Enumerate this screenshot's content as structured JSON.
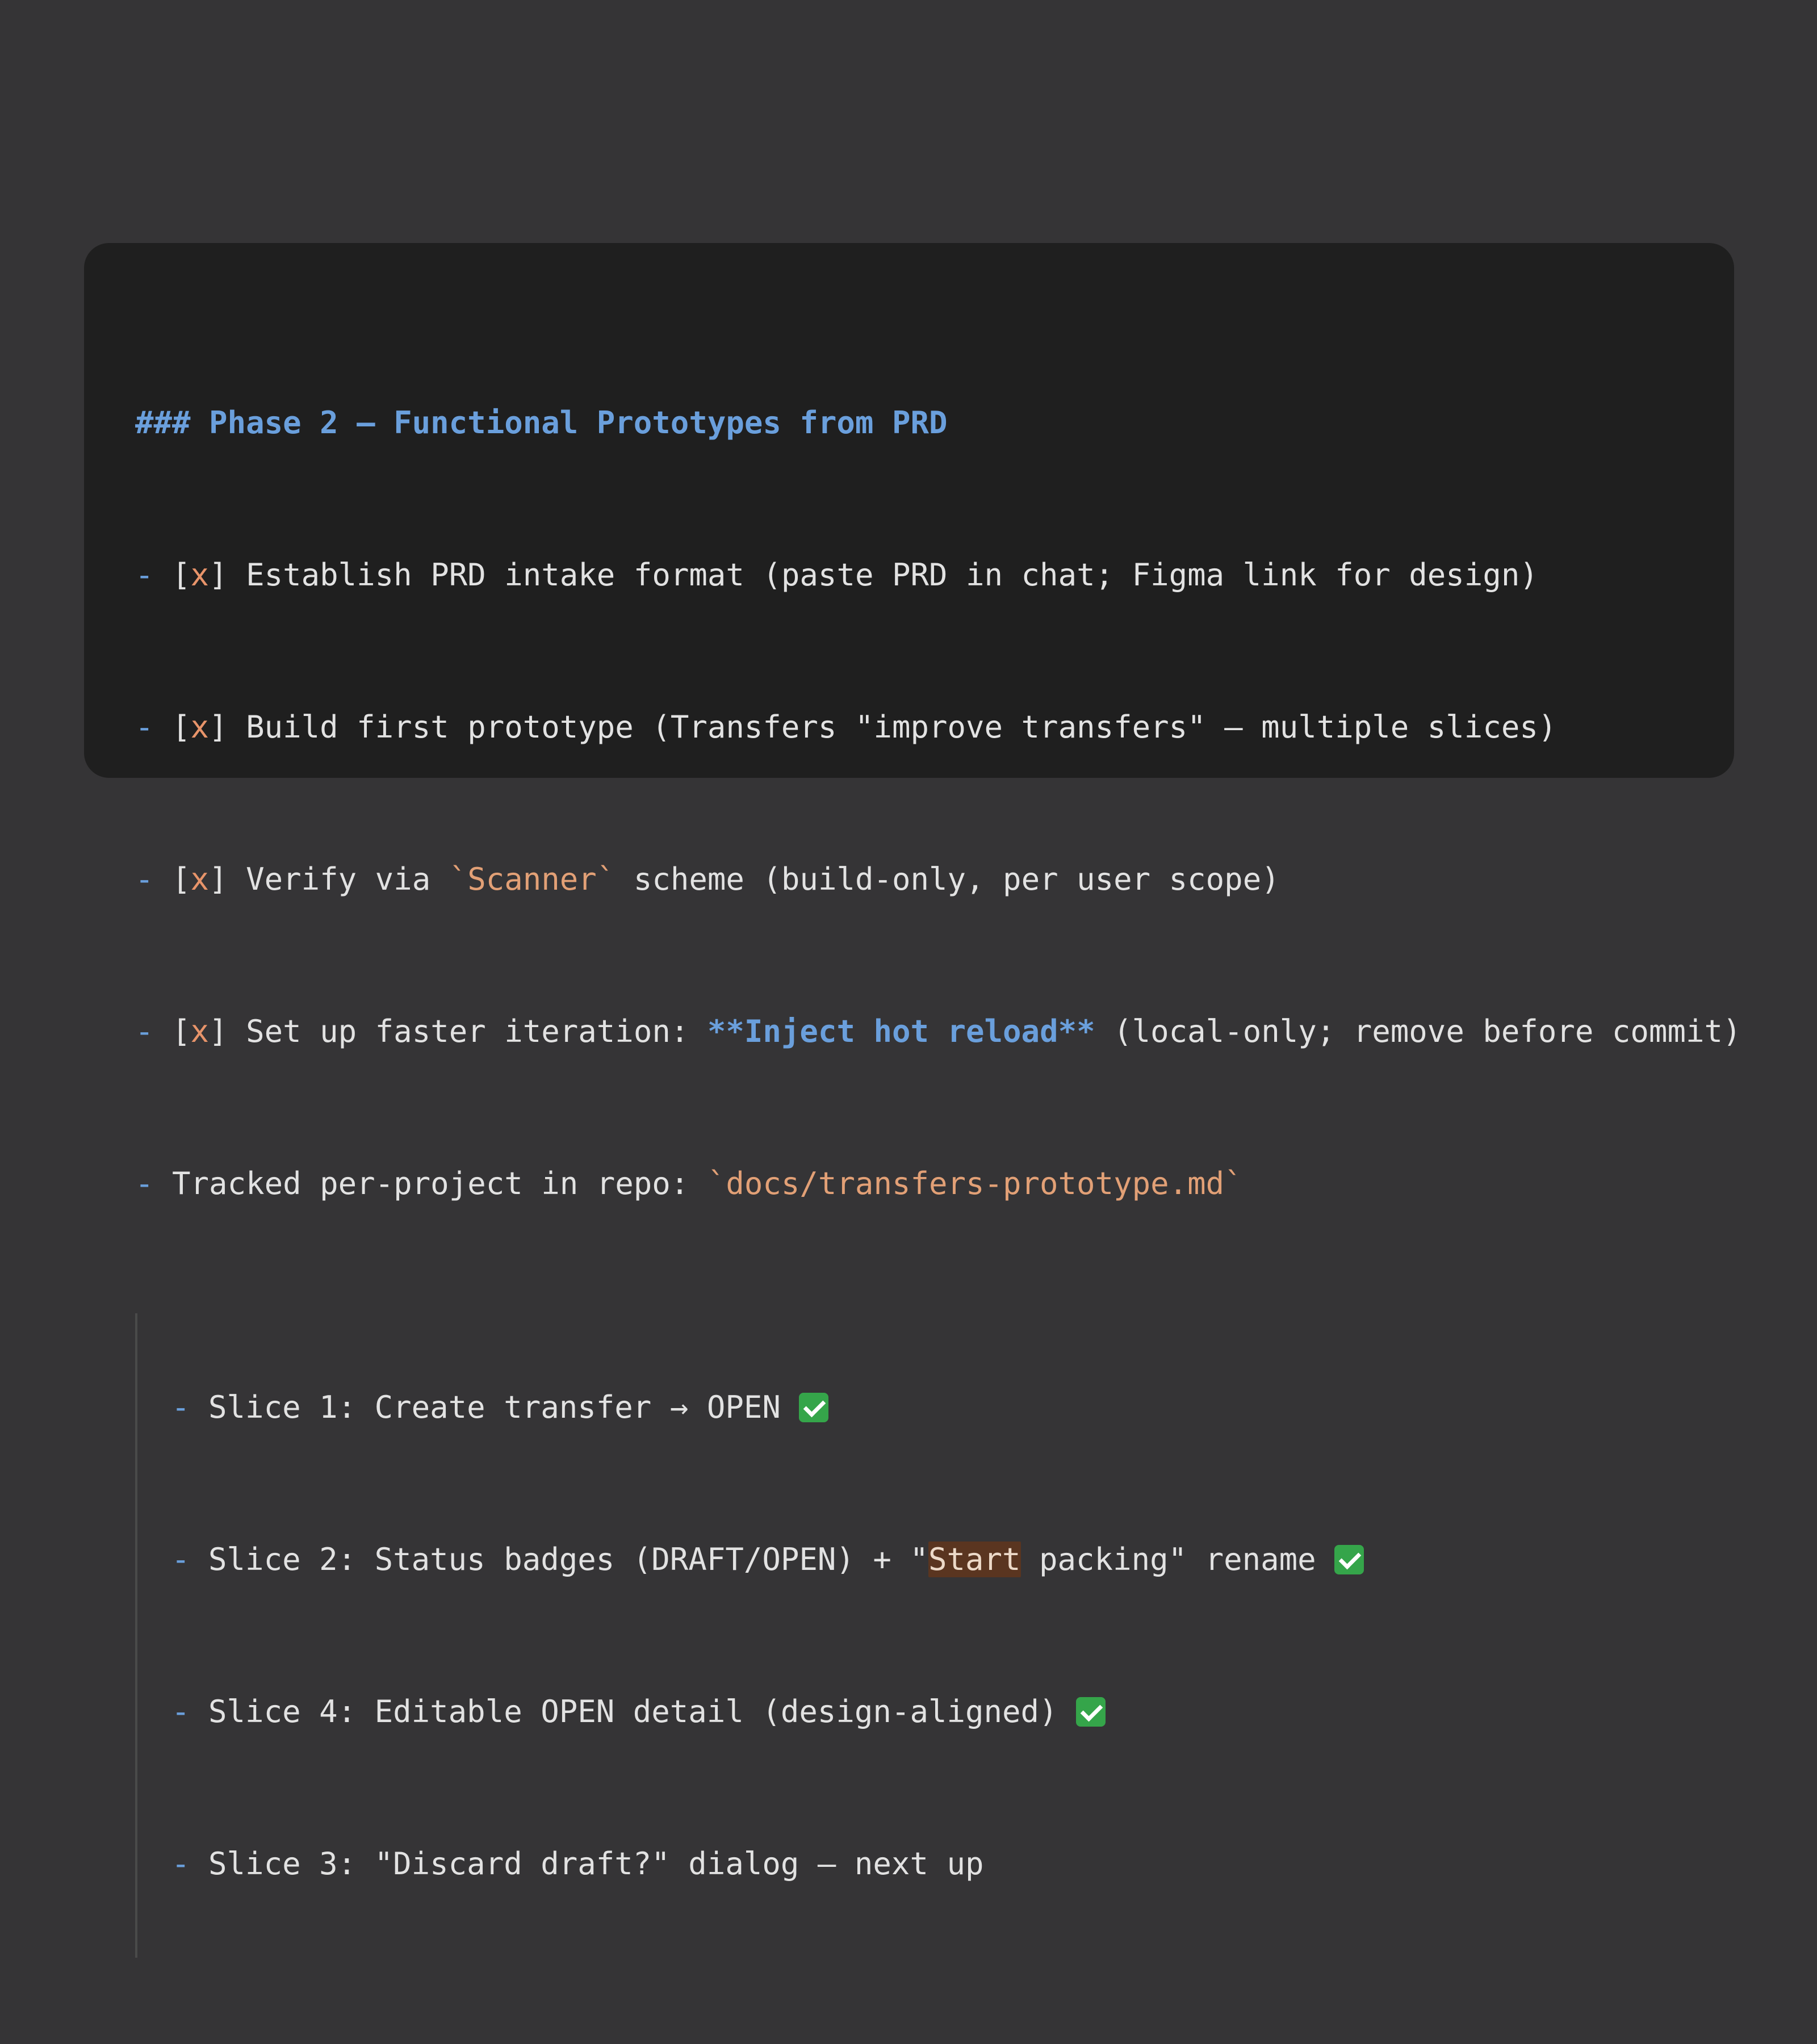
{
  "colors": {
    "background": "#353436",
    "panel": "#1f1f1f",
    "heading": "#6a9fdc",
    "text": "#e2e2e2",
    "inline_code": "#e2a076",
    "check_mark": "#e8946a",
    "highlight": "#5a3520",
    "check_emoji": "#35a54a"
  },
  "heading": "### Phase 2 — Functional Prototypes from PRD",
  "dash": "- ",
  "checkbox_open": "[",
  "checkbox_mark": "x",
  "checkbox_close": "] ",
  "items": [
    {
      "text": "Establish PRD intake format (paste PRD in chat; Figma link for design)"
    },
    {
      "text": "Build first prototype (Transfers \"improve transfers\" — multiple slices)"
    },
    {
      "before": "Verify via ",
      "code": "`Scanner`",
      "after": " scheme (build-only, per user scope)"
    },
    {
      "before": "Set up faster iteration: ",
      "bold": "**Inject hot reload**",
      "after": " (local-only; remove before commit)"
    }
  ],
  "tracked": {
    "before": "Tracked per-project in repo: ",
    "code": "`docs/transfers-prototype.md`"
  },
  "slices": [
    {
      "text": "Slice 1: Create transfer → OPEN ",
      "check_icon": "check-mark-button-emoji"
    },
    {
      "before": "Slice 2: Status badges (DRAFT/OPEN) + \"",
      "highlight": "Start",
      "after": " packing\" rename ",
      "check_icon": "check-mark-button-emoji"
    },
    {
      "text": "Slice 4: Editable OPEN detail (design-aligned) ",
      "check_icon": "check-mark-button-emoji"
    },
    {
      "text": "Slice 3: \"Discard draft?\" dialog — next up"
    }
  ]
}
